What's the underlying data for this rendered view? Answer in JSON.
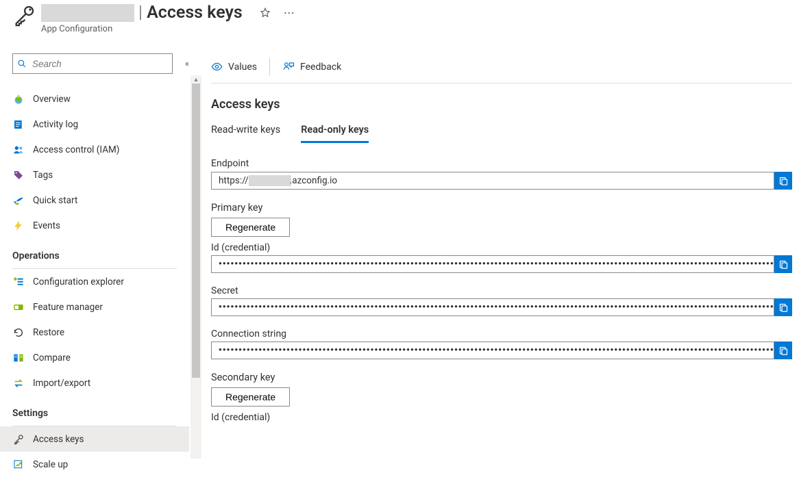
{
  "header": {
    "title": "Access keys",
    "subtitle": "App Configuration"
  },
  "sidebar": {
    "search_placeholder": "Search",
    "groups": [
      {
        "title": null,
        "items": [
          {
            "key": "overview",
            "label": "Overview"
          },
          {
            "key": "activity",
            "label": "Activity log"
          },
          {
            "key": "iam",
            "label": "Access control (IAM)"
          },
          {
            "key": "tags",
            "label": "Tags"
          },
          {
            "key": "quickstart",
            "label": "Quick start"
          },
          {
            "key": "events",
            "label": "Events"
          }
        ]
      },
      {
        "title": "Operations",
        "items": [
          {
            "key": "configexplorer",
            "label": "Configuration explorer"
          },
          {
            "key": "featuremgr",
            "label": "Feature manager"
          },
          {
            "key": "restore",
            "label": "Restore"
          },
          {
            "key": "compare",
            "label": "Compare"
          },
          {
            "key": "importexport",
            "label": "Import/export"
          }
        ]
      },
      {
        "title": "Settings",
        "items": [
          {
            "key": "accesskeys",
            "label": "Access keys"
          },
          {
            "key": "scaleup",
            "label": "Scale up"
          }
        ]
      }
    ]
  },
  "toolbar": {
    "values_label": "Values",
    "feedback_label": "Feedback"
  },
  "main": {
    "section_title": "Access keys",
    "tabs": {
      "rw": "Read-write keys",
      "ro": "Read-only keys"
    },
    "endpoint_label": "Endpoint",
    "endpoint_prefix": "https://",
    "endpoint_suffix": ".azconfig.io",
    "primary_title": "Primary key",
    "secondary_title": "Secondary key",
    "regenerate_label": "Regenerate",
    "id_label": "Id (credential)",
    "secret_label": "Secret",
    "conn_label": "Connection string",
    "masked": "●●●●●●●●●●●●●●●●●●●●●●●●●●●●●●●●●●●●●●●●●●●●●●●●●●●●●●●●●●●●●●●●●●●●●●●●●●●●●●●●●●●●●●●●●●●●●●●●●●●●●●●●●●●●●●●●●●●●●●●●●●●●●●●●●●●●●●●●●●●●●●●●●●●●●●●●●●●"
  }
}
